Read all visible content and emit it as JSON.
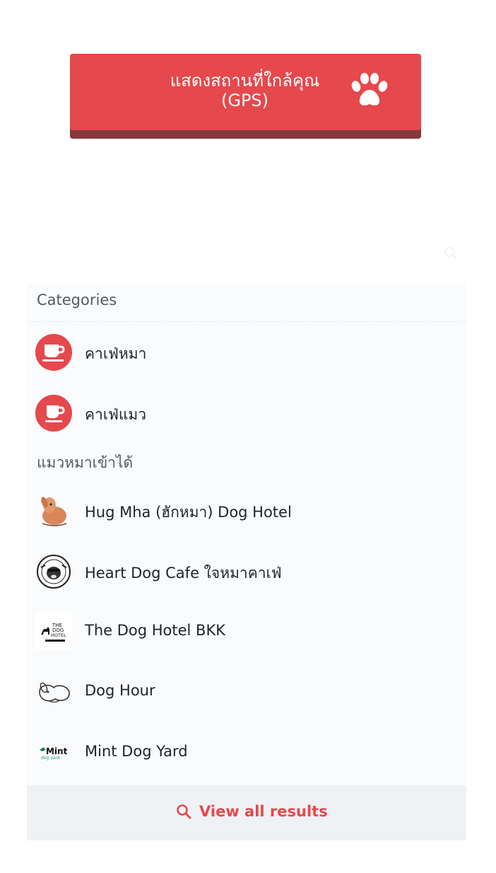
{
  "gps_button": {
    "label": "แสดงสถานที่ใกล้คุณ\n(GPS)",
    "icon": "paw-icon"
  },
  "search": {
    "placeholder": "",
    "icon": "search-icon"
  },
  "categories": {
    "title": "Categories",
    "items": [
      {
        "label": "คาเฟ่หมา",
        "icon": "coffee-cup-icon"
      },
      {
        "label": "คาเฟ่แมว",
        "icon": "coffee-cup-icon"
      }
    ]
  },
  "places": {
    "title": "แมวหมาเข้าได้",
    "items": [
      {
        "label": "Hug Mha (ฮักหมา) Dog Hotel",
        "icon": "hug-mha-logo"
      },
      {
        "label": "Heart Dog Cafe ใจหมาคาเฟ่",
        "icon": "heart-dog-cafe-logo"
      },
      {
        "label": "The Dog Hotel BKK",
        "icon": "the-dog-hotel-logo"
      },
      {
        "label": "Dog Hour",
        "icon": "dog-hour-logo"
      },
      {
        "label": "Mint Dog Yard",
        "icon": "mint-dog-yard-logo"
      }
    ]
  },
  "view_all": {
    "label": "View all results",
    "icon": "search-icon"
  },
  "colors": {
    "accent": "#e5484d",
    "button_shadow": "#86393d",
    "panel_bg": "#fafbfd"
  }
}
